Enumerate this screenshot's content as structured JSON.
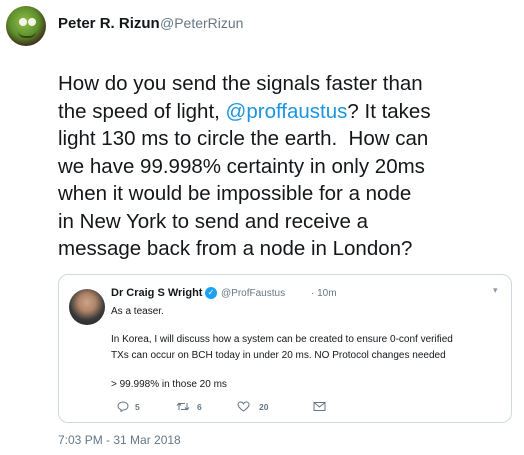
{
  "author": {
    "name": "Peter R. Rizun",
    "handle": "@PeterRizun"
  },
  "tweet": {
    "lines": [
      "How do you send the signals faster than",
      "the speed of light, ",
      "@proffaustus",
      "? It takes",
      "light 130 ms to circle the earth.  How can",
      "we have 99.998% certainty in only 20ms",
      "when it would be impossible for a node",
      "in New York to send and receive a",
      "message back from a node in London?"
    ],
    "timestamp": "7:03 PM - 31 Mar 2018"
  },
  "quoted_tweet": {
    "name": "Dr Craig S Wright",
    "handle": "@ProfFaustus",
    "time": "· 10m",
    "lines": [
      "As a teaser.",
      "In Korea, I will discuss how a system can be created to ensure 0-conf verified",
      "TXs can occur on BCH today in under 20 ms. NO Protocol changes needed",
      "> 99.998% in those 20 ms"
    ],
    "reply_count": "5",
    "retweet_count": "6",
    "like_count": "20"
  },
  "colors": {
    "text": "#14171a",
    "secondary": "#657786",
    "link": "#1b95e0",
    "verified": "#1da1f2",
    "border": "#cfd9de"
  }
}
